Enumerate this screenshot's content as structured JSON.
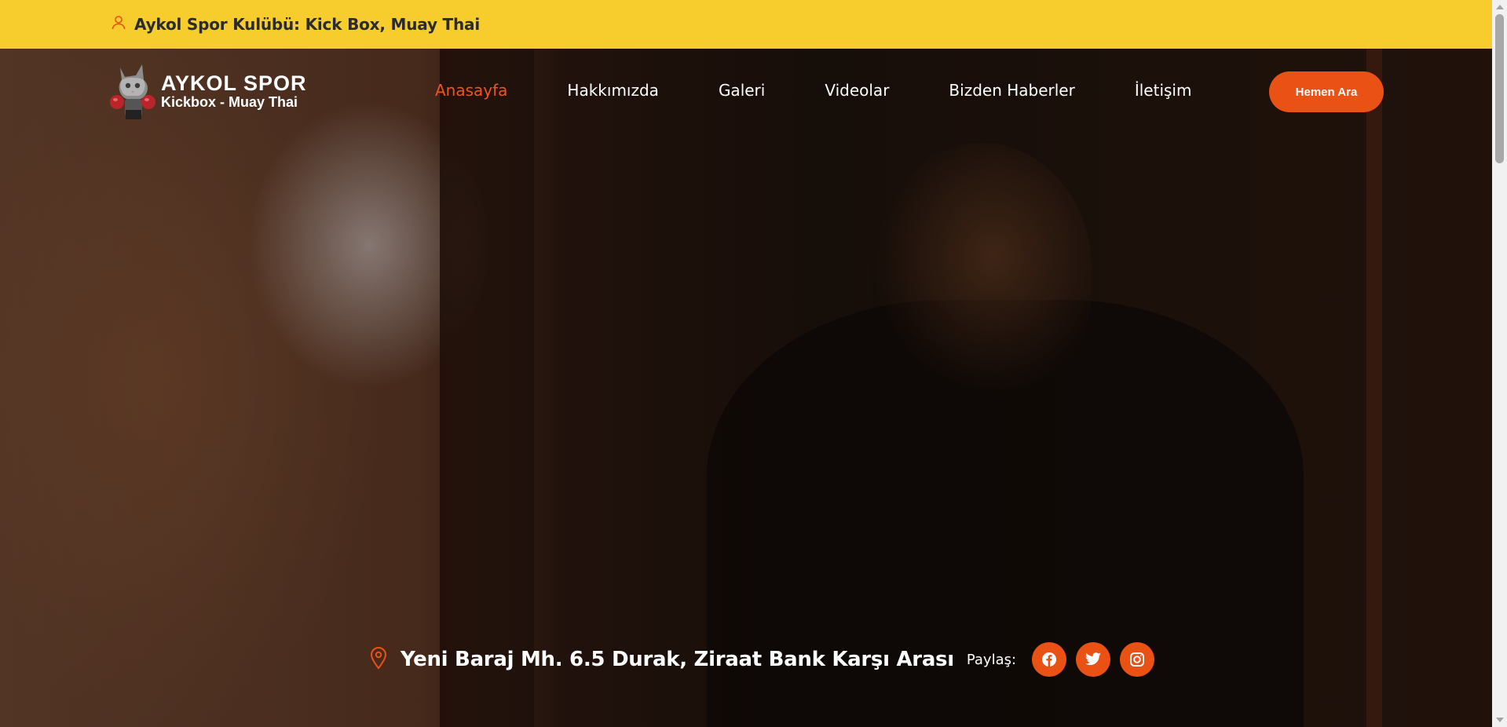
{
  "topbar": {
    "title": "Aykol Spor Kulübü: Kick Box, Muay Thai",
    "icon": "user-icon"
  },
  "logo": {
    "line1": "AYKOL SPOR",
    "line2": "Kickbox - Muay Thai",
    "icon": "boxing-cat-logo"
  },
  "nav": {
    "items": [
      {
        "label": "Anasayfa",
        "active": true
      },
      {
        "label": "Hakkımızda"
      },
      {
        "label": "Galeri"
      },
      {
        "label": "Videolar"
      },
      {
        "label": "Bizden Haberler"
      },
      {
        "label": "İletişim"
      }
    ]
  },
  "cta": {
    "label": "Hemen Ara"
  },
  "footer": {
    "address": "Yeni Baraj Mh. 6.5 Durak, Ziraat Bank Karşı Arası",
    "share_label": "Paylaş:",
    "social": [
      "facebook-icon",
      "twitter-icon",
      "instagram-icon"
    ]
  },
  "colors": {
    "accent": "#ea5115",
    "topbar": "#f7cd2e",
    "active_nav": "#f0541e"
  }
}
